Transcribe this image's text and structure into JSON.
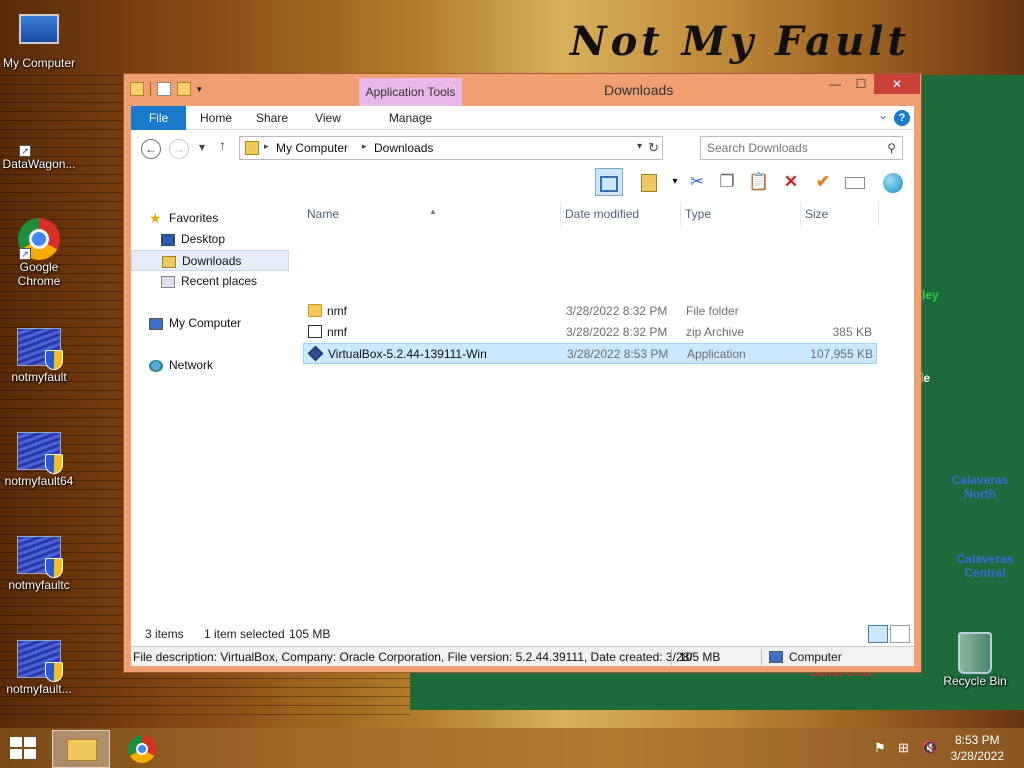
{
  "wallpaper": {
    "title": "Not My Fault",
    "map_labels": [
      "ley",
      "le",
      "Calaveras North",
      "Calaveras Central",
      "Santa Cruz"
    ]
  },
  "desktop": {
    "icons": [
      {
        "label": "My Computer",
        "icon": "my-computer-icon"
      },
      {
        "label": "DataWagon...",
        "icon": "datawagon-icon"
      },
      {
        "label": "Google Chrome",
        "icon": "chrome-icon"
      },
      {
        "label": "notmyfault",
        "icon": "app-shield-icon"
      },
      {
        "label": "notmyfault64",
        "icon": "app-shield-icon"
      },
      {
        "label": "notmyfaultc",
        "icon": "app-shield-icon"
      },
      {
        "label": "notmyfault...",
        "icon": "app-shield-icon"
      },
      {
        "label": "Recycle Bin",
        "icon": "recycle-bin-icon"
      }
    ]
  },
  "window": {
    "title": "Downloads",
    "contextual_tab": "Application Tools",
    "controls": {
      "minimize": "—",
      "maximize": "☐",
      "close": "✕"
    },
    "ribbon_tabs": [
      "File",
      "Home",
      "Share",
      "View",
      "Manage"
    ],
    "help": "?",
    "address": {
      "crumbs": [
        "My Computer",
        "Downloads"
      ]
    },
    "search": {
      "placeholder": "Search Downloads"
    },
    "nav": {
      "favorites": "Favorites",
      "items": [
        "Desktop",
        "Downloads",
        "Recent places"
      ],
      "computer": "My Computer",
      "network": "Network"
    },
    "columns": [
      "Name",
      "Date modified",
      "Type",
      "Size"
    ],
    "files": [
      {
        "name": "nmf",
        "date": "3/28/2022 8:32 PM",
        "type": "File folder",
        "size": "",
        "icon": "folder-icon"
      },
      {
        "name": "nmf",
        "date": "3/28/2022 8:32 PM",
        "type": "zip Archive",
        "size": "385 KB",
        "icon": "zip-icon"
      },
      {
        "name": "VirtualBox-5.2.44-139111-Win",
        "date": "3/28/2022 8:53 PM",
        "type": "Application",
        "size": "107,955 KB",
        "icon": "virtualbox-icon"
      }
    ],
    "status": {
      "count": "3 items",
      "selection": "1 item selected",
      "size": "105 MB"
    },
    "details": {
      "description": "File description: VirtualBox, Company: Oracle Corporation, File version: 5.2.44.39111, Date created: 3/28/",
      "size": "105 MB",
      "location": "Computer"
    }
  },
  "taskbar": {
    "time": "8:53 PM",
    "date": "3/28/2022"
  }
}
